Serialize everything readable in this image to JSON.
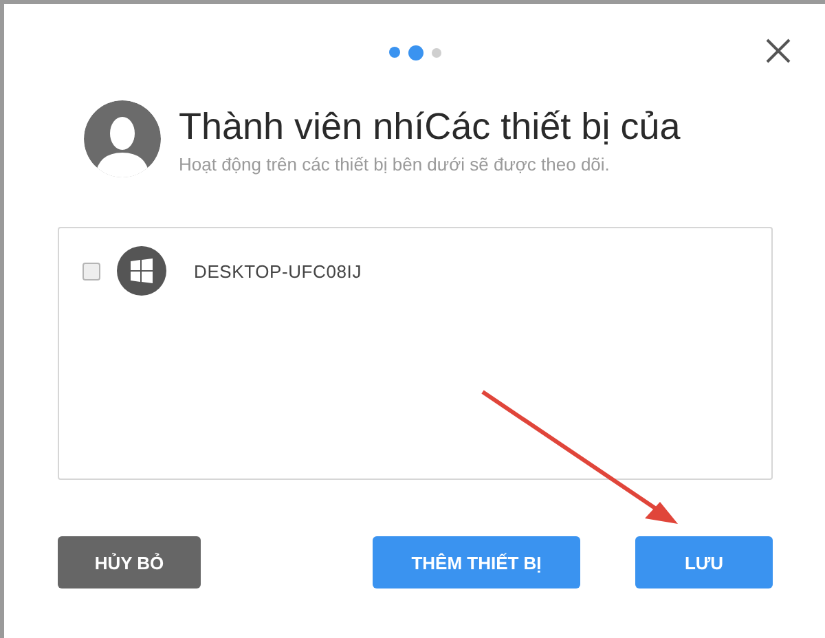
{
  "steps": [
    {
      "kind": "done"
    },
    {
      "kind": "current"
    },
    {
      "kind": "pending"
    }
  ],
  "header": {
    "title": "Thành viên nhíCác thiết bị của",
    "subtitle": "Hoạt động trên các thiết bị bên dưới sẽ được theo dõi."
  },
  "devices": [
    {
      "name": "DESKTOP-UFC08IJ",
      "checked": false
    }
  ],
  "buttons": [
    {
      "label": "HỦY BỎ",
      "kind": "secondary"
    },
    {
      "label": "THÊM THIẾT BỊ",
      "kind": "primary"
    },
    {
      "label": "LƯU",
      "kind": "primary"
    }
  ]
}
